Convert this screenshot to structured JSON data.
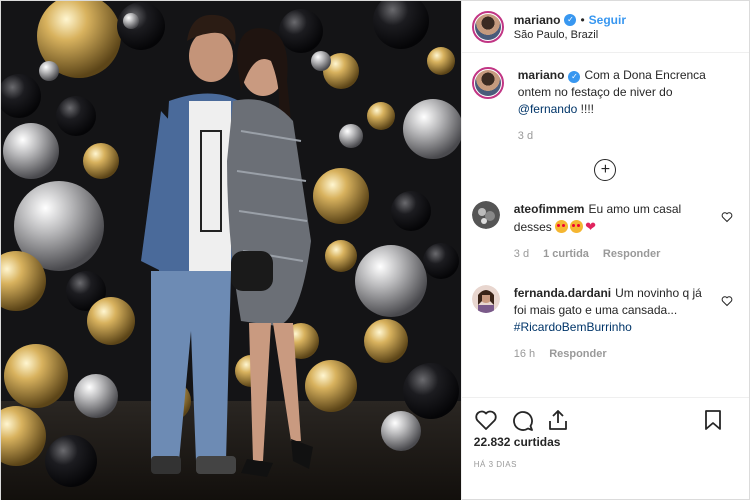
{
  "post": {
    "username": "mariano",
    "follow_label": "Seguir",
    "separator": "•",
    "location": "São Paulo, Brazil",
    "verified": true
  },
  "caption": {
    "username": "mariano",
    "text": "Com a Dona Encrenca ontem no festaço de niver do",
    "mention": "@fernando",
    "suffix": " !!!!",
    "time": "3 d"
  },
  "comments": [
    {
      "username": "ateofimmem",
      "text": "Eu amo um casal desses",
      "emojis": [
        "smiling-heart-eyes-icon",
        "smiling-heart-eyes-icon",
        "red-heart-icon"
      ],
      "time": "3 d",
      "likes_label": "1 curtida",
      "reply_label": "Responder"
    },
    {
      "username": "fernanda.dardani",
      "text": "Um novinho q já foi mais gato e uma cansada...",
      "hashtag": "#RicardoBemBurrinho",
      "time": "16 h",
      "reply_label": "Responder"
    }
  ],
  "load_more_icon": "plus-circle-icon",
  "actions": [
    "heart-icon",
    "comment-icon",
    "share-icon",
    "bookmark-icon"
  ],
  "likes_count": "22.832 curtidas",
  "posted_ago": "HÁ 3 DIAS",
  "colors": {
    "link_blue": "#3897f0",
    "mention_blue": "#003569",
    "muted_gray": "#999999",
    "border": "#efefef"
  }
}
